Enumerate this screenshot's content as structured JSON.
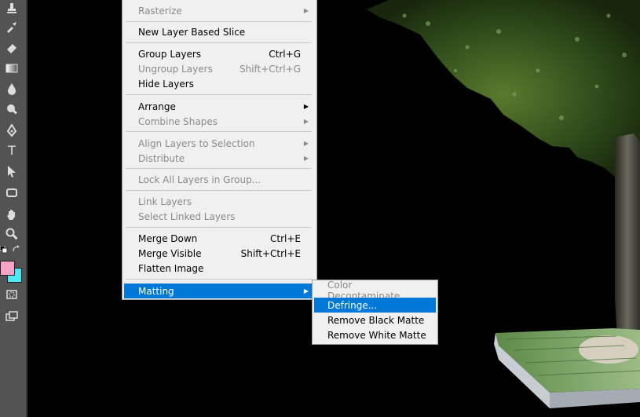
{
  "toolbar": {
    "icons": [
      "stamp-icon",
      "history-brush-icon",
      "eraser-icon",
      "gradient-icon",
      "blur-icon",
      "dodge-icon",
      "pen-icon",
      "type-icon",
      "path-selection-icon",
      "rectangle-shape-icon",
      "hand-icon",
      "zoom-icon",
      "default-colors-icon",
      "swap-colors-icon",
      "quick-mask-icon",
      "screen-mode-icon"
    ],
    "type_tool_glyph": "T",
    "foreground_color": "#f5a3c7",
    "background_color": "#4de8f5"
  },
  "menu": {
    "items": [
      {
        "label": "Rasterize",
        "shortcut": "",
        "submenu": true,
        "disabled": true
      },
      {
        "label": "New Layer Based Slice",
        "shortcut": "",
        "submenu": false,
        "disabled": false
      },
      {
        "label": "Group Layers",
        "shortcut": "Ctrl+G",
        "submenu": false,
        "disabled": false
      },
      {
        "label": "Ungroup Layers",
        "shortcut": "Shift+Ctrl+G",
        "submenu": false,
        "disabled": true
      },
      {
        "label": "Hide Layers",
        "shortcut": "",
        "submenu": false,
        "disabled": false
      },
      {
        "label": "Arrange",
        "shortcut": "",
        "submenu": true,
        "disabled": false
      },
      {
        "label": "Combine Shapes",
        "shortcut": "",
        "submenu": true,
        "disabled": true
      },
      {
        "label": "Align Layers to Selection",
        "shortcut": "",
        "submenu": true,
        "disabled": true
      },
      {
        "label": "Distribute",
        "shortcut": "",
        "submenu": true,
        "disabled": true
      },
      {
        "label": "Lock All Layers in Group...",
        "shortcut": "",
        "submenu": false,
        "disabled": true
      },
      {
        "label": "Link Layers",
        "shortcut": "",
        "submenu": false,
        "disabled": true
      },
      {
        "label": "Select Linked Layers",
        "shortcut": "",
        "submenu": false,
        "disabled": true
      },
      {
        "label": "Merge Down",
        "shortcut": "Ctrl+E",
        "submenu": false,
        "disabled": false
      },
      {
        "label": "Merge Visible",
        "shortcut": "Shift+Ctrl+E",
        "submenu": false,
        "disabled": false
      },
      {
        "label": "Flatten Image",
        "shortcut": "",
        "submenu": false,
        "disabled": false
      },
      {
        "label": "Matting",
        "shortcut": "",
        "submenu": true,
        "disabled": false,
        "highlighted": true
      }
    ],
    "submenu_arrow": "▶"
  },
  "submenu": {
    "items": [
      {
        "label": "Color Decontaminate...",
        "disabled": true
      },
      {
        "label": "Defringe...",
        "disabled": false,
        "highlighted": true
      },
      {
        "label": "Remove Black Matte",
        "disabled": false
      },
      {
        "label": "Remove White Matte",
        "disabled": false
      }
    ]
  },
  "colors": {
    "menu_highlight": "#0078d7",
    "menu_bg": "#f0f0f0",
    "toolbar_bg": "#535353"
  }
}
